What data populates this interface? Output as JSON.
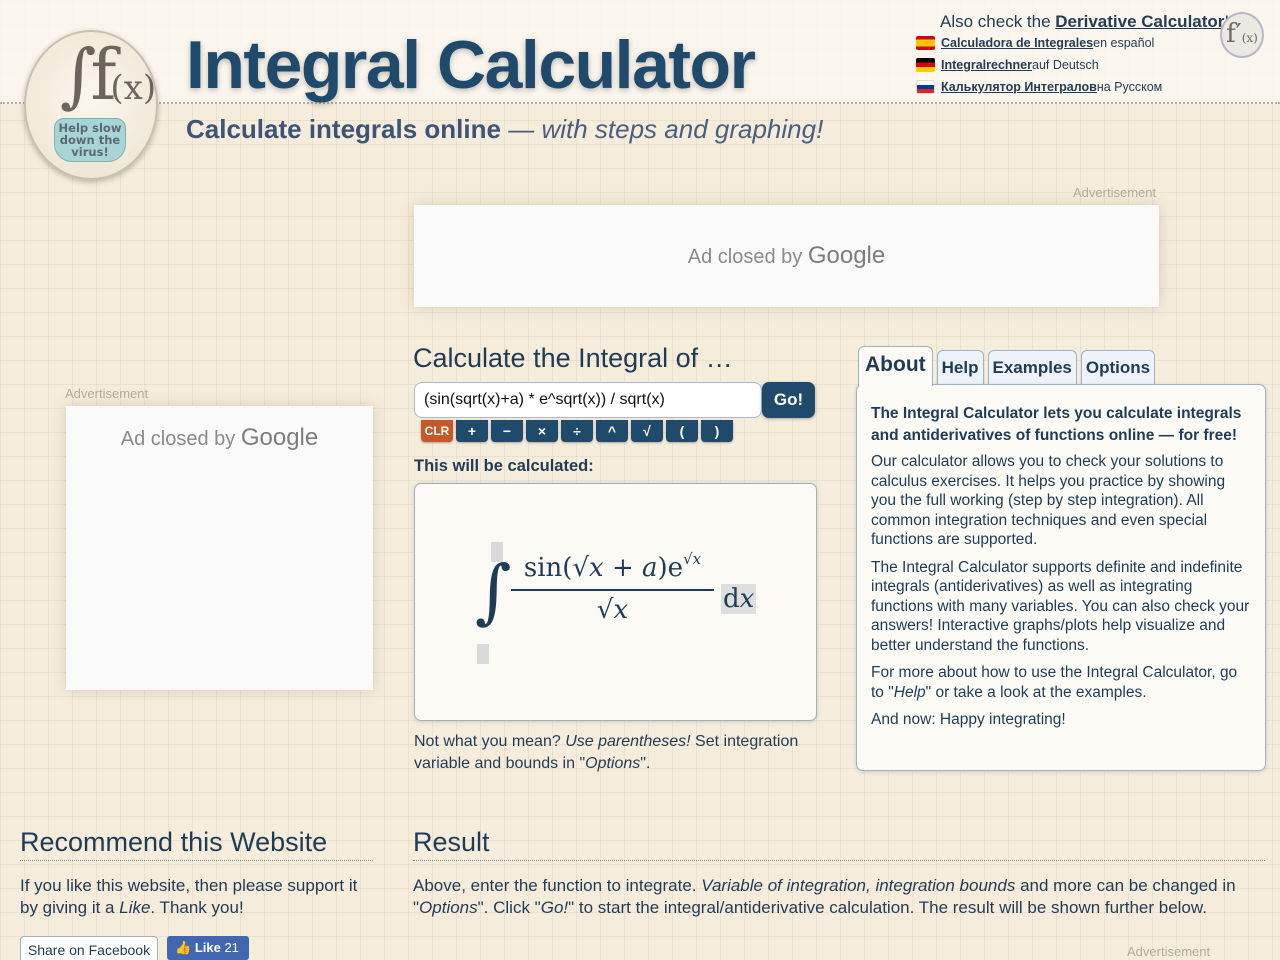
{
  "header": {
    "title": "Integral Calculator",
    "subtitle_bold": "Calculate integrals online",
    "subtitle_italic": "— with steps and graphing!",
    "logo_text": [
      "Help slow",
      "down the",
      "virus!"
    ],
    "also_check_prefix": "Also check the ",
    "also_check_link": "Derivative Calculator",
    "also_check_suffix": "!",
    "languages": [
      {
        "flag": "flag-spain",
        "link": "Calculadora de Integrales",
        "suffix": " en español"
      },
      {
        "flag": "flag-germany",
        "link": "Integralrechner",
        "suffix": " auf Deutsch"
      },
      {
        "flag": "flag-russia",
        "link": "Калькулятор Интегралов",
        "suffix": " на Русском"
      }
    ]
  },
  "ads": {
    "label": "Advertisement",
    "closed_text": "Ad closed by ",
    "closed_brand": "Google"
  },
  "calculator": {
    "heading": "Calculate the Integral of …",
    "input_value": "(sin(sqrt(x)+a) * e^sqrt(x)) / sqrt(x)",
    "go_label": "Go!",
    "keys": [
      "CLR",
      "+",
      "−",
      "×",
      "÷",
      "^",
      "√",
      "(",
      ")"
    ],
    "will_be_calculated": "This will be calculated:",
    "hint_1": "Not what you mean? ",
    "hint_italic": "Use parentheses!",
    "hint_2": " Set integration variable and bounds in \"",
    "hint_options": "Options",
    "hint_3": "\"."
  },
  "tabs": [
    {
      "label": "About",
      "active": true
    },
    {
      "label": "Help",
      "active": false
    },
    {
      "label": "Examples",
      "active": false
    },
    {
      "label": "Options",
      "active": false
    }
  ],
  "about": {
    "lead": "The Integral Calculator lets you calculate integrals and antiderivatives of functions online — for free!",
    "p1": "Our calculator allows you to check your solutions to calculus exercises. It helps you practice by showing you the full working (step by step integration). All common integration techniques and even special functions are supported.",
    "p2": "The Integral Calculator supports definite and indefinite integrals (antiderivatives) as well as integrating functions with many variables. You can also check your answers! Interactive graphs/plots help visualize and better understand the functions.",
    "p3_a": "For more about how to use the Integral Calculator, go to \"",
    "p3_help": "Help",
    "p3_b": "\" or take a look at the examples.",
    "p4": "And now: Happy integrating!"
  },
  "recommend": {
    "heading": "Recommend this Website",
    "text_a": "If you like this website, then please support it by giving it a ",
    "text_like": "Like",
    "text_b": ". Thank you!",
    "share_label": "Share on Facebook",
    "like_label": "Like",
    "like_count": "21"
  },
  "result": {
    "heading": "Result",
    "text_a": "Above, enter the function to integrate. ",
    "text_italic": "Variable of integration, integration bounds",
    "text_b": " and more can be changed in \"",
    "text_options": "Options",
    "text_c": "\". Click \"",
    "text_go": "Go!",
    "text_d": "\" to start the integral/antiderivative calculation. The result will be shown further below."
  }
}
